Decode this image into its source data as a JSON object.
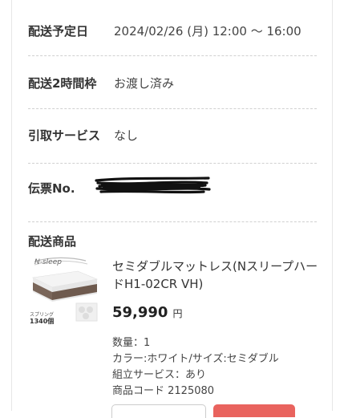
{
  "delivery": {
    "date_label": "配送予定日",
    "date_value": "2024/02/26 (月) 12:00 ～ 16:00",
    "slot_label": "配送2時間枠",
    "slot_value": "お渡し済み",
    "pickup_label": "引取サービス",
    "pickup_value": "なし",
    "tracking_label": "伝票No.",
    "tracking_value_redacted": true
  },
  "products": {
    "section_title": "配送商品",
    "item": {
      "image_brand_text": "N-sleep",
      "image_caption_spring": "スプリング",
      "image_caption_count": "1340個",
      "name": "セミダブルマットレス(NスリープハードH1-02CR VH)",
      "price": "59,990",
      "currency": "円",
      "quantity": "数量：1",
      "color_size": "カラー:ホワイト/サイズ:セミダブル",
      "assembly": "組立サービス：あり",
      "product_code": "商品コード 2125080"
    }
  },
  "colors": {
    "accent_red": "#e9635e",
    "divider": "#d0d0d0"
  }
}
